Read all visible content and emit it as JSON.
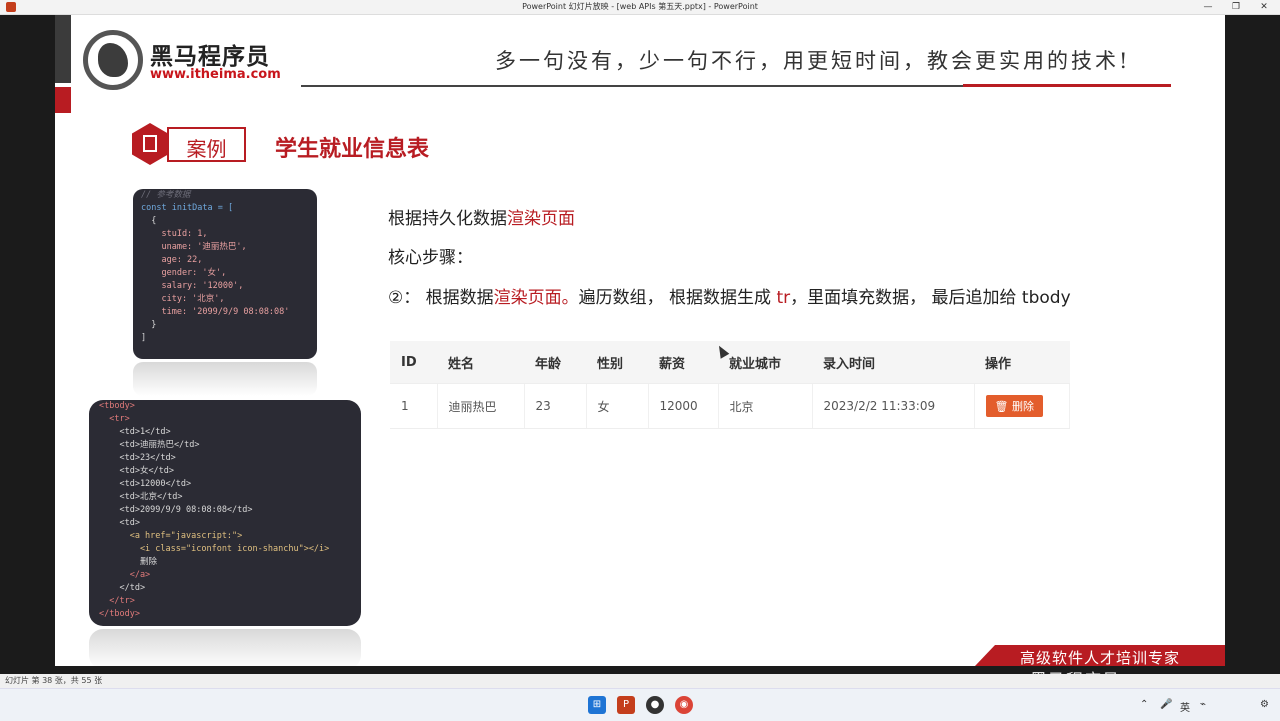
{
  "window": {
    "title": "PowerPoint 幻灯片放映 - [web APIs 第五天.pptx] - PowerPoint",
    "minimize": "—",
    "restore": "❐",
    "close": "✕"
  },
  "header": {
    "logo_cn": "黑马程序员",
    "logo_url": "www.itheima.com",
    "slogan": "多一句没有，少一句不行，用更短时间，教会更实用的技术!"
  },
  "case": {
    "label": "案例",
    "title": "学生就业信息表"
  },
  "code_js": [
    {
      "cls": "c-comment",
      "text": "// 参考数据"
    },
    {
      "cls": "c-kw",
      "text": "const initData = ["
    },
    {
      "cls": "c-plain",
      "text": "  {"
    },
    {
      "cls": "c-prop",
      "text": "    stuId: 1,"
    },
    {
      "cls": "c-prop",
      "text": "    uname: '迪丽热巴',"
    },
    {
      "cls": "c-prop",
      "text": "    age: 22,"
    },
    {
      "cls": "c-prop",
      "text": "    gender: '女',"
    },
    {
      "cls": "c-prop",
      "text": "    salary: '12000',"
    },
    {
      "cls": "c-prop",
      "text": "    city: '北京',"
    },
    {
      "cls": "c-prop",
      "text": "    time: '2099/9/9 08:08:08'"
    },
    {
      "cls": "c-plain",
      "text": "  }"
    },
    {
      "cls": "c-plain",
      "text": "]"
    }
  ],
  "code_html": [
    {
      "cls": "c-tag",
      "text": "<tbody>"
    },
    {
      "cls": "c-tag",
      "text": "  <tr>"
    },
    {
      "cls": "c-plain",
      "text": "    <td>1</td>"
    },
    {
      "cls": "c-plain",
      "text": "    <td>迪丽热巴</td>"
    },
    {
      "cls": "c-plain",
      "text": "    <td>23</td>"
    },
    {
      "cls": "c-plain",
      "text": "    <td>女</td>"
    },
    {
      "cls": "c-plain",
      "text": "    <td>12000</td>"
    },
    {
      "cls": "c-plain",
      "text": "    <td>北京</td>"
    },
    {
      "cls": "c-plain",
      "text": "    <td>2099/9/9 08:08:08</td>"
    },
    {
      "cls": "c-plain",
      "text": "    <td>"
    },
    {
      "cls": "c-attr",
      "text": "      <a href=\"javascript:\">"
    },
    {
      "cls": "c-attr",
      "text": "        <i class=\"iconfont icon-shanchu\"></i>"
    },
    {
      "cls": "c-plain",
      "text": "        删除"
    },
    {
      "cls": "c-tag",
      "text": "      </a>"
    },
    {
      "cls": "c-plain",
      "text": "    </td>"
    },
    {
      "cls": "c-tag",
      "text": "  </tr>"
    },
    {
      "cls": "c-tag",
      "text": "</tbody>"
    }
  ],
  "content": {
    "line1_plain": "根据持久化数据",
    "line1_red": "渲染页面",
    "line2": "核心步骤：",
    "line3_a": "②：  根据数据",
    "line3_red": "渲染页面。",
    "line3_b": "遍历数组， 根据数据生成 ",
    "line3_red2": "tr",
    "line3_c": "，里面填充数据， 最后追加给 tbody"
  },
  "table": {
    "headers": [
      "ID",
      "姓名",
      "年龄",
      "性别",
      "薪资",
      "就业城市",
      "录入时间",
      "操作"
    ],
    "rows": [
      {
        "id": "1",
        "name": "迪丽热巴",
        "age": "23",
        "gender": "女",
        "salary": "12000",
        "city": "北京",
        "time": "2023/2/2 11:33:09",
        "action": "🗑 删除"
      }
    ]
  },
  "footer": {
    "banner": "高级软件人才培训专家",
    "overlay": "黑马程序员"
  },
  "status": {
    "slide_info": "幻灯片 第 38 张，共 55 张"
  },
  "tray": {
    "lang": "英",
    "time_icons": "⚙"
  }
}
